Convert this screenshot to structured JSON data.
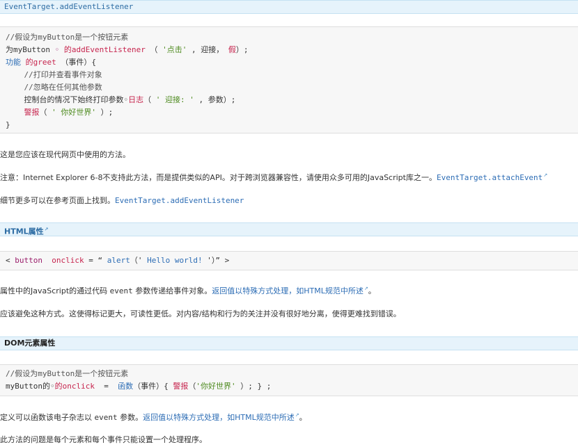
{
  "section1": {
    "header_link": "EventTarget.addEventListener",
    "code": {
      "l1": "//假设为myButton是一个按钮元素",
      "l2a": "为myButton",
      "l2b": " ◦ ",
      "l2c": "的addEventListener",
      "l2d": " （ ",
      "l2e": "'点击'",
      "l2f": " , 迎接， ",
      "l2g": "假",
      "l2h": "）;",
      "l3a": "功能 ",
      "l3b": "的greet",
      "l3c": " （事件）{",
      "l4": "    //打印并查看事件对象",
      "l5": "    //忽略在任何其他参数",
      "l6a": "    控制台的情况下始终打印参数◦",
      "l6b": "日志",
      "l6c": "（ ",
      "l6d": "' 迎接: '",
      "l6e": " , 参数）;",
      "l7a": "    ",
      "l7b": "警报",
      "l7c": "（ ",
      "l7d": "' 你好世界'",
      "l7e": " ）;",
      "l8": "}"
    }
  },
  "para1": "这是您应该在现代网页中使用的方法。",
  "para2": {
    "text": "注意：Internet Explorer 6-8不支持此方法，而是提供类似的API。对于跨浏览器兼容性，请使用众多可用的JavaScript库之一。",
    "link": "EventTarget.attachEvent"
  },
  "para3": {
    "text": "细节更多可以在参考页面上找到。",
    "link": "EventTarget.addEventListener"
  },
  "section2": {
    "header": "HTML属性",
    "code": {
      "a": "< ",
      "b": "button",
      "c": "  onclick",
      "d": " = “ ",
      "e": "alert",
      "f": "（' ",
      "g": "Hello world! ",
      "h": "'）” >"
    }
  },
  "para4": {
    "t1": "属性中的JavaScript的通过代码 ",
    "t2": "event",
    "t3": " 参数传递给事件对象。",
    "link": "返回值以特殊方式处理，如HTML规范中所述",
    "t4": "。"
  },
  "para5": "应该避免这种方式。这使得标记更大，可读性更低。对内容/结构和行为的关注并没有很好地分离，使得更难找到错误。",
  "section3": {
    "header": "DOM元素属性",
    "code": {
      "l1": "//假设为myButton是一个按钮元素",
      "l2a": "myButton的◦",
      "l2b": "的onclick",
      "l2c": "  =  ",
      "l2d": "函数",
      "l2e": "（事件）{ ",
      "l2f": "警报",
      "l2g": "（",
      "l2h": "'你好世界'",
      "l2i": " ）; } ;"
    }
  },
  "para6": {
    "t1": "定义可以函数该电子杂志以 ",
    "t2": "event",
    "t3": " 参数。",
    "link": "返回值以特殊方式处理，如HTML规范中所述",
    "t4": "。"
  },
  "para7": "此方法的问题是每个元素和每个事件只能设置一个处理程序。",
  "ext_icon": "external-link-icon"
}
